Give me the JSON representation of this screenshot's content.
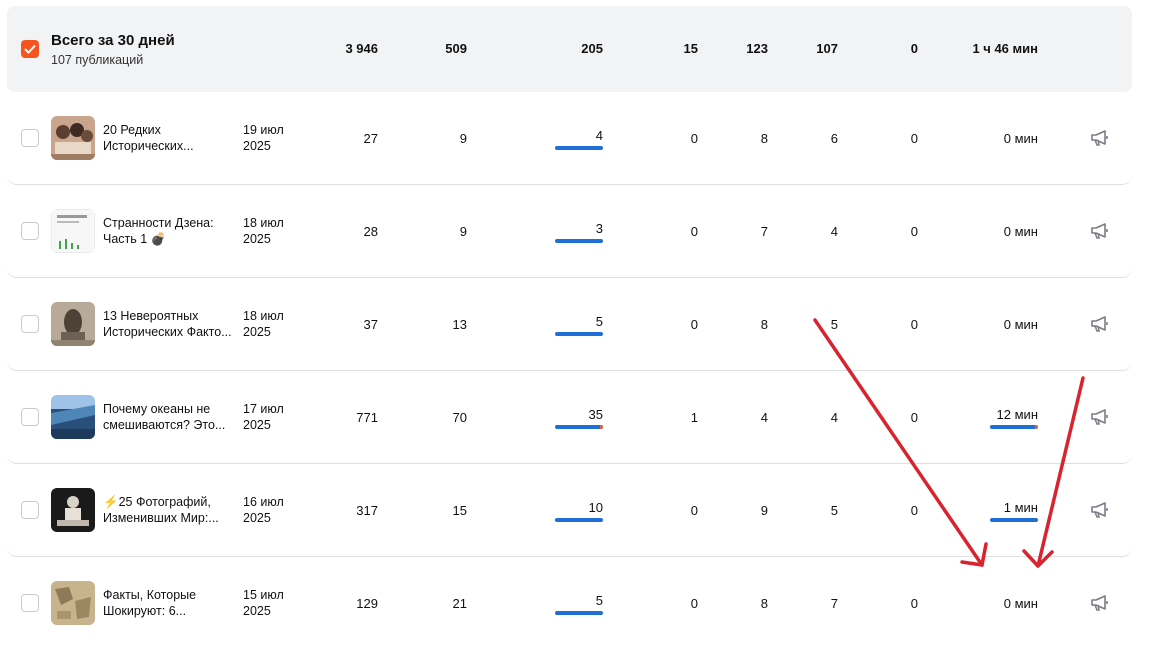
{
  "summary": {
    "title": "Всего за 30 дней",
    "subtitle": "107 публикаций",
    "checked": true,
    "stats": [
      "3 946",
      "509",
      "205",
      "15",
      "123",
      "107",
      "0",
      "1 ч 46 мин"
    ]
  },
  "rows": [
    {
      "title1": "20 Редких",
      "title2": "Исторических...",
      "date1": "19 июл",
      "date2": "2025",
      "c1": "27",
      "c2": "9",
      "c3": "4",
      "c4": "0",
      "c5": "8",
      "c6": "6",
      "c7": "0",
      "c8": "0 мин",
      "thumb": "photo-vintage"
    },
    {
      "title1": "Странности Дзена:",
      "title2": "Часть 1 💣",
      "date1": "18 июл",
      "date2": "2025",
      "c1": "28",
      "c2": "9",
      "c3": "3",
      "c4": "0",
      "c5": "7",
      "c6": "4",
      "c7": "0",
      "c8": "0 мин",
      "thumb": "screenshot-chart"
    },
    {
      "title1": "13 Невероятных",
      "title2": "Исторических Факто...",
      "date1": "18 июл",
      "date2": "2025",
      "c1": "37",
      "c2": "13",
      "c3": "5",
      "c4": "0",
      "c5": "8",
      "c6": "5",
      "c7": "0",
      "c8": "0 мин",
      "thumb": "photo-statue"
    },
    {
      "title1": "Почему океаны не",
      "title2": "смешиваются? Это...",
      "date1": "17 июл",
      "date2": "2025",
      "c1": "771",
      "c2": "70",
      "c3": "35",
      "c4": "1",
      "c5": "4",
      "c6": "4",
      "c7": "0",
      "c8": "12 мин",
      "thumb": "photo-ocean"
    },
    {
      "title1": "⚡25 Фотографий,",
      "title2": "Изменивших Мир:...",
      "date1": "16 июл",
      "date2": "2025",
      "c1": "317",
      "c2": "15",
      "c3": "10",
      "c4": "0",
      "c5": "9",
      "c6": "5",
      "c7": "0",
      "c8": "1 мин",
      "thumb": "photo-dark"
    },
    {
      "title1": "Факты, Которые",
      "title2": "Шокируют: 6...",
      "date1": "15 июл",
      "date2": "2025",
      "c1": "129",
      "c2": "21",
      "c3": "5",
      "c4": "0",
      "c5": "8",
      "c6": "7",
      "c7": "0",
      "c8": "0 мин",
      "thumb": "photo-map"
    }
  ],
  "colors": {
    "accent": "#f5541e",
    "bar": "#1f6fd6",
    "arrow": "#d9232e"
  }
}
